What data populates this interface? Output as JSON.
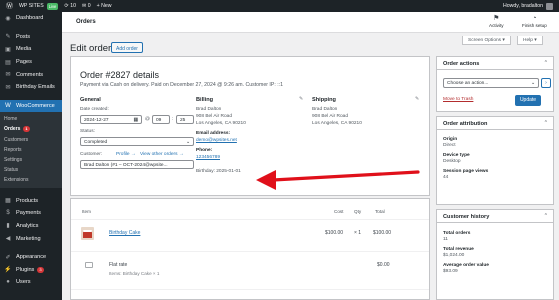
{
  "adminbar": {
    "wp_logo": "wordpress-icon",
    "site_name": "WP SITES",
    "live_badge": "Live",
    "updates_count": "10",
    "comments_count": "0",
    "new_label": "+ New",
    "howdy": "Howdy, bradalton"
  },
  "sidebar": {
    "items": [
      {
        "label": "Dashboard",
        "icon": "dashboard-icon",
        "glyph": "◉"
      },
      {
        "label": "Posts",
        "icon": "posts-icon",
        "glyph": "✎"
      },
      {
        "label": "Media",
        "icon": "media-icon",
        "glyph": "▣"
      },
      {
        "label": "Pages",
        "icon": "pages-icon",
        "glyph": "▤"
      },
      {
        "label": "Comments",
        "icon": "comments-icon",
        "glyph": "✉"
      },
      {
        "label": "Birthday Emails",
        "icon": "birthday-emails-icon",
        "glyph": "✉"
      },
      {
        "label": "WooCommerce",
        "icon": "woocommerce-icon",
        "glyph": "W"
      }
    ],
    "woo_sub": [
      {
        "label": "Home"
      },
      {
        "label": "Orders",
        "count": "1"
      },
      {
        "label": "Customers"
      },
      {
        "label": "Reports"
      },
      {
        "label": "Settings"
      },
      {
        "label": "Status"
      },
      {
        "label": "Extensions"
      }
    ],
    "items2": [
      {
        "label": "Products",
        "icon": "products-icon",
        "glyph": "▦"
      },
      {
        "label": "Payments",
        "icon": "payments-icon",
        "glyph": "$"
      },
      {
        "label": "Analytics",
        "icon": "analytics-icon",
        "glyph": "▮"
      },
      {
        "label": "Marketing",
        "icon": "marketing-icon",
        "glyph": "◀"
      },
      {
        "label": "Appearance",
        "icon": "appearance-icon",
        "glyph": "✐"
      },
      {
        "label": "Plugins",
        "icon": "plugins-icon",
        "glyph": "⚡",
        "count": "3"
      },
      {
        "label": "Users",
        "icon": "users-icon",
        "glyph": "●"
      }
    ]
  },
  "header": {
    "title": "Orders",
    "activity": "Activity",
    "finish_setup": "Finish setup"
  },
  "screen_options": "Screen Options ▾",
  "help": "Help ▾",
  "page": {
    "heading": "Edit order",
    "add_order": "Add order"
  },
  "order": {
    "title": "Order #2827 details",
    "meta": "Payment via Cash on delivery. Paid on December 27, 2024 @ 9:26 am. Customer IP: ::1",
    "general": {
      "heading": "General",
      "date_label": "Date created:",
      "date": "2024-12-27",
      "at": "@",
      "hour": "09",
      "minute": "25",
      "status_label": "Status:",
      "status": "Completed",
      "customer_label": "Customer:",
      "profile_link": "Profile →",
      "view_orders_link": "View other orders →",
      "customer": "Brad Dalton (#1 – OCT-2024@wpsite..."
    },
    "billing": {
      "heading": "Billing",
      "name": "Brad Dalton",
      "address1": "908 Bel Air Road",
      "address2": "Los Angeles, CA 90210",
      "email_label": "Email address:",
      "email": "demo@wpsites.net",
      "phone_label": "Phone:",
      "phone": "123456789",
      "birthday": "Birthday: 2025-01-01"
    },
    "shipping": {
      "heading": "Shipping",
      "name": "Brad Dalton",
      "address1": "908 Bel Air Road",
      "address2": "Los Angeles, CA 90210"
    }
  },
  "items": {
    "headers": {
      "item": "Item",
      "cost": "Cost",
      "qty": "Qty",
      "total": "Total"
    },
    "product": {
      "name": "Birthday Cake",
      "cost": "$100.00",
      "qty": "× 1",
      "total": "$100.00"
    },
    "shipping": {
      "name": "Flat rate",
      "items_note": "Items: Birthday Cake × 1",
      "total": "$0.00"
    }
  },
  "actions_box": {
    "title": "Order actions",
    "select_placeholder": "Choose an action...",
    "go": "›",
    "trash": "Move to Trash",
    "update": "Update"
  },
  "attribution_box": {
    "title": "Order attribution",
    "origin_label": "Origin",
    "origin": "Direct",
    "device_label": "Device type",
    "device": "Desktop",
    "views_label": "Session page views",
    "views": "44"
  },
  "history_box": {
    "title": "Customer history",
    "total_orders_label": "Total orders",
    "total_orders": "11",
    "revenue_label": "Total revenue",
    "revenue": "$1,024.00",
    "avg_label": "Average order value",
    "avg": "$93.09"
  },
  "colors": {
    "admin_dark": "#1d2327",
    "accent": "#2271b1",
    "arrow": "#e0101a",
    "danger": "#b32d2e"
  }
}
